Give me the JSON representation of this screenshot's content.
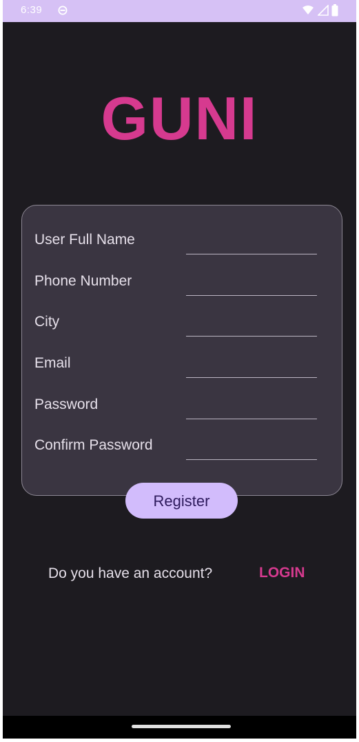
{
  "status_bar": {
    "time": "6:39",
    "icons": [
      "dnd-icon",
      "wifi-icon",
      "signal-icon",
      "battery-icon"
    ]
  },
  "app": {
    "logo_text": "GUNI",
    "brand_color": "#d63a8f"
  },
  "form": {
    "fields": [
      {
        "label": "User Full Name",
        "value": ""
      },
      {
        "label": "Phone Number",
        "value": ""
      },
      {
        "label": "City",
        "value": ""
      },
      {
        "label": "Email",
        "value": ""
      },
      {
        "label": "Password",
        "value": ""
      },
      {
        "label": "Confirm Password",
        "value": ""
      }
    ],
    "register_label": "Register"
  },
  "footer": {
    "account_prompt": "Do you have an account?",
    "login_label": "LOGIN"
  },
  "colors": {
    "background": "#1d1b20",
    "card": "#3a3541",
    "status_bar": "#d6c1f5",
    "button": "#d2bcfc",
    "button_text": "#2d1a5c"
  }
}
